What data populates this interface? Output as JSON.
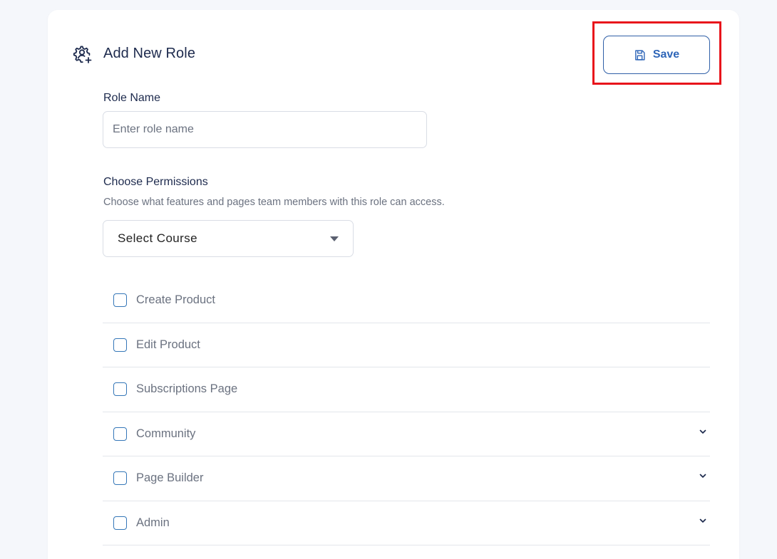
{
  "header": {
    "title": "Add New Role",
    "icon": "user-gear-icon",
    "save_label": "Save",
    "save_icon": "floppy-disk-icon",
    "accent_color": "#2f66b8",
    "highlight_color": "#e8141b"
  },
  "role_name": {
    "label": "Role Name",
    "placeholder": "Enter role name",
    "value": ""
  },
  "permissions": {
    "title": "Choose Permissions",
    "helper": "Choose what features and pages team members with this role can access.",
    "select": {
      "selected": "Select Course",
      "icon": "caret-down-icon"
    },
    "items": [
      {
        "label": "Create Product",
        "checked": false,
        "expandable": false
      },
      {
        "label": "Edit Product",
        "checked": false,
        "expandable": false
      },
      {
        "label": "Subscriptions Page",
        "checked": false,
        "expandable": false
      },
      {
        "label": "Community",
        "checked": false,
        "expandable": true
      },
      {
        "label": "Page Builder",
        "checked": false,
        "expandable": true
      },
      {
        "label": "Admin",
        "checked": false,
        "expandable": true
      }
    ]
  }
}
